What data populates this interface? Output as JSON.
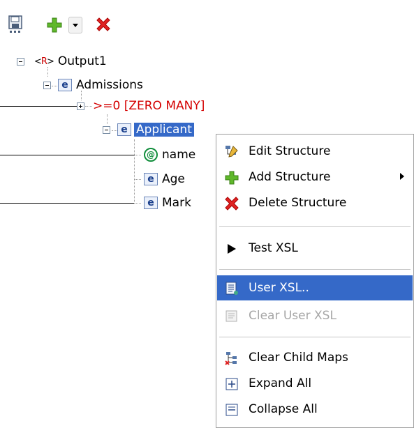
{
  "toolbar": {
    "save_icon": "save-icon",
    "add_icon": "add-icon",
    "dropdown_icon": "dropdown-icon",
    "delete_icon": "delete-icon"
  },
  "tree": {
    "root": {
      "tag_open": "<",
      "tag_r": "R",
      "tag_close": ">",
      "label": "Output1"
    },
    "admissions": {
      "icon": "e",
      "label": "Admissions"
    },
    "zero_many": {
      "label": ">=0 [ZERO MANY]"
    },
    "applicant": {
      "icon": "e",
      "label": "Applicant"
    },
    "name": {
      "icon": "@",
      "label": "name"
    },
    "age": {
      "icon": "e",
      "label": "Age"
    },
    "mark": {
      "icon": "e",
      "label": "Mark"
    }
  },
  "menu": {
    "items": [
      {
        "label": "Edit Structure"
      },
      {
        "label": "Add Structure"
      },
      {
        "label": "Delete Structure"
      },
      {
        "label": "Test XSL"
      },
      {
        "label": "User XSL.."
      },
      {
        "label": "Clear User XSL"
      },
      {
        "label": "Clear Child Maps"
      },
      {
        "label": "Expand All"
      },
      {
        "label": "Collapse All"
      }
    ]
  },
  "colors": {
    "selection": "#3569c8",
    "cardinality": "#d40000"
  }
}
